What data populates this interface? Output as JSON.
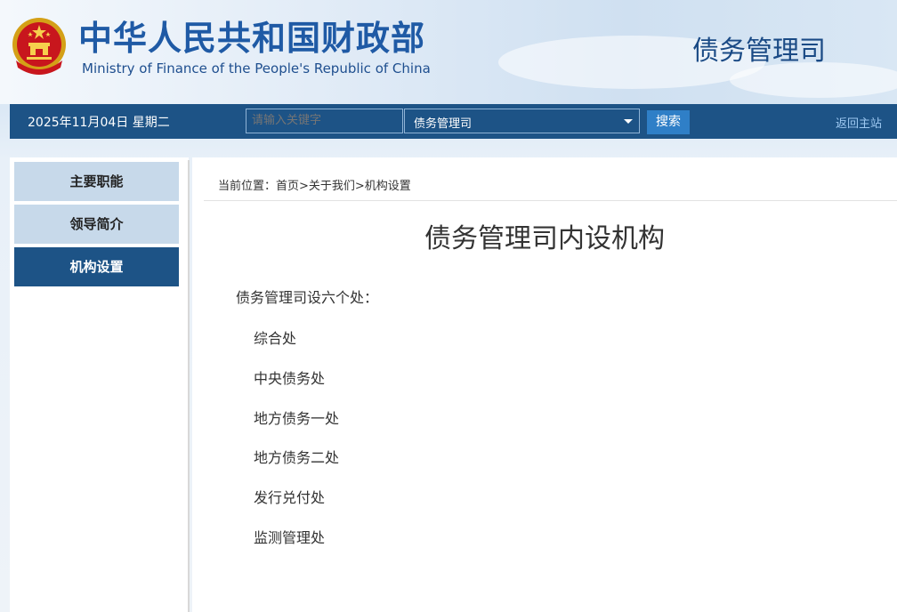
{
  "header": {
    "ministry_cn": "中华人民共和国财政部",
    "ministry_en": "Ministry of Finance of the People's Republic of China",
    "department": "债务管理司"
  },
  "navbar": {
    "date": "2025年11月04日  星期二",
    "search_placeholder": "请输入关键字",
    "scope_value": "债务管理司",
    "search_button": "搜索",
    "home_link": "返回主站"
  },
  "sidebar": {
    "items": [
      {
        "label": "主要职能",
        "active": false
      },
      {
        "label": "领导简介",
        "active": false
      },
      {
        "label": "机构设置",
        "active": true
      }
    ]
  },
  "breadcrumb": "当前位置：首页>关于我们>机构设置",
  "article": {
    "title": "债务管理司内设机构",
    "intro": "债务管理司设六个处：",
    "offices": [
      "综合处",
      "中央债务处",
      "地方债务一处",
      "地方债务二处",
      "发行兑付处",
      "监测管理处"
    ]
  },
  "colors": {
    "nav_bg": "#1d5386",
    "accent_blue": "#1f5aa5",
    "sidebar_inactive": "#c7d9ea",
    "search_button": "#2f7fc7"
  }
}
